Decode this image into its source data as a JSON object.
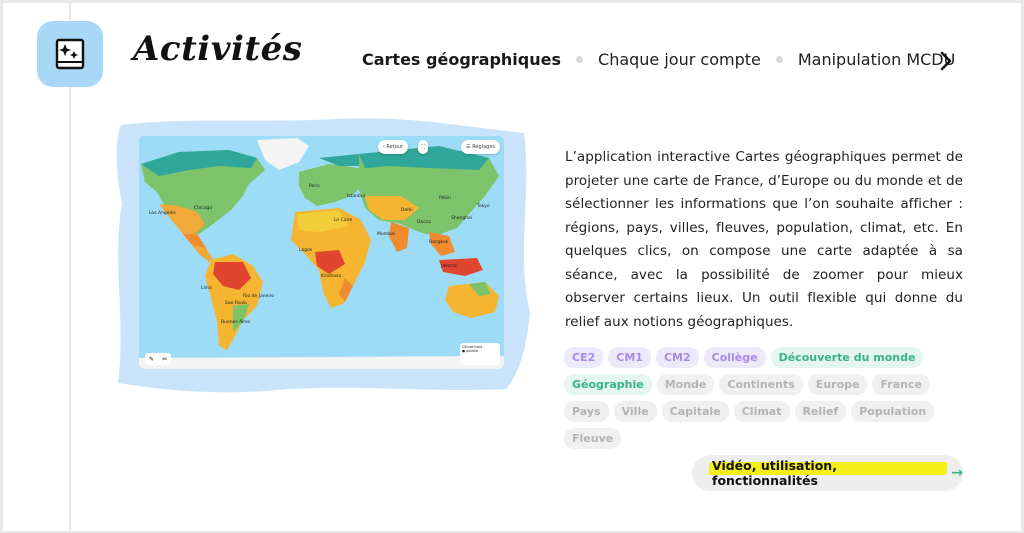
{
  "header": {
    "title": "Activités",
    "app_icon": "book-sparkle-icon"
  },
  "tabs": [
    {
      "label": "Cartes géographiques",
      "active": true
    },
    {
      "label": "Chaque jour compte",
      "active": false
    },
    {
      "label": "Manipulation MCDU",
      "active": false
    }
  ],
  "next_icon": "chevron-right-icon",
  "map": {
    "back_label": "Retour",
    "settings_label": "Réglages",
    "legend_title": "Climat froid",
    "legend_item": "polaire",
    "labels": {
      "los_angeles": "Los Angeles",
      "chicago": "Chicago",
      "lima": "Lima",
      "sao_paulo": "Sao Paulo",
      "rio": "Rio de Janeiro",
      "buenos_aires": "Buenos Aires",
      "paris": "Paris",
      "le_caire": "Le Caire",
      "lagos": "Lagos",
      "kinshasa": "Kinshasa",
      "mumbai": "Mumbai",
      "pekin": "Pékin",
      "tokyo": "Tokyo",
      "shanghai": "Shanghai",
      "dacca": "Dacca",
      "bangkok": "Bangkok",
      "jakarta": "Jakarta",
      "delhi": "Delhi",
      "istanbul": "Istanbul"
    }
  },
  "description": "L’application interactive Cartes géographiques permet de projeter une carte de France, d’Europe ou du monde et de sélectionner les informations que l’on souhaite afficher : régions, pays, villes, fleuves, population, climat, etc. En quelques clics, on compose une carte adaptée à sa séance, avec la possibilité de zoomer pour mieux observer certains lieux. Un outil flexible qui donne du relief aux notions géographiques.",
  "tags": [
    {
      "label": "CE2",
      "kind": "level"
    },
    {
      "label": "CM1",
      "kind": "level"
    },
    {
      "label": "CM2",
      "kind": "level"
    },
    {
      "label": "Collège",
      "kind": "level"
    },
    {
      "label": "Découverte du monde",
      "kind": "theme"
    },
    {
      "label": "Géographie",
      "kind": "theme"
    },
    {
      "label": "Monde",
      "kind": "keyword"
    },
    {
      "label": "Continents",
      "kind": "keyword"
    },
    {
      "label": "Europe",
      "kind": "keyword"
    },
    {
      "label": "France",
      "kind": "keyword"
    },
    {
      "label": "Pays",
      "kind": "keyword"
    },
    {
      "label": "Ville",
      "kind": "keyword"
    },
    {
      "label": "Capitale",
      "kind": "keyword"
    },
    {
      "label": "Climat",
      "kind": "keyword"
    },
    {
      "label": "Relief",
      "kind": "keyword"
    },
    {
      "label": "Population",
      "kind": "keyword"
    },
    {
      "label": "Fleuve",
      "kind": "keyword"
    }
  ],
  "cta": {
    "label": "Vidéo, utilisation, fonctionnalités",
    "icon": "arrow-right-icon"
  },
  "colors": {
    "icon_bg": "#a9d8f6",
    "level_tag": "#a88ae6",
    "theme_tag": "#37b28c",
    "highlight": "#f4ee19",
    "ocean": "#9ddcf7"
  }
}
